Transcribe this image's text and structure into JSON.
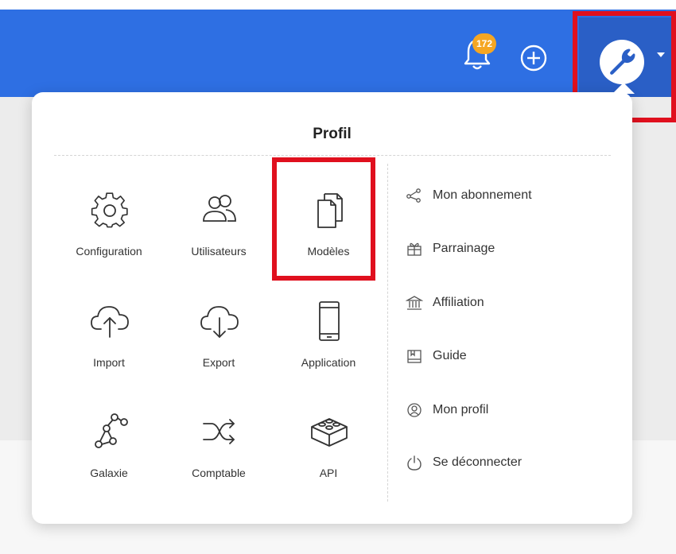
{
  "header": {
    "notification_count": "172",
    "accent": "#2e6fe3",
    "badge_color": "#f5a623",
    "highlight_color": "#e0101e"
  },
  "menu": {
    "title": "Profil",
    "tiles": [
      {
        "label": "Configuration",
        "icon": "gear-icon"
      },
      {
        "label": "Utilisateurs",
        "icon": "users-icon"
      },
      {
        "label": "Modèles",
        "icon": "documents-icon"
      },
      {
        "label": "Import",
        "icon": "cloud-upload-icon"
      },
      {
        "label": "Export",
        "icon": "cloud-download-icon"
      },
      {
        "label": "Application",
        "icon": "phone-icon"
      },
      {
        "label": "Galaxie",
        "icon": "nodes-icon"
      },
      {
        "label": "Comptable",
        "icon": "shuffle-icon"
      },
      {
        "label": "API",
        "icon": "lego-brick-icon"
      }
    ],
    "links": [
      {
        "label": "Mon abonnement",
        "icon": "share-icon"
      },
      {
        "label": "Parrainage",
        "icon": "gift-icon"
      },
      {
        "label": "Affiliation",
        "icon": "bank-icon"
      },
      {
        "label": "Guide",
        "icon": "book-icon"
      },
      {
        "label": "Mon profil",
        "icon": "profile-icon"
      },
      {
        "label": "Se déconnecter",
        "icon": "power-icon"
      }
    ]
  }
}
